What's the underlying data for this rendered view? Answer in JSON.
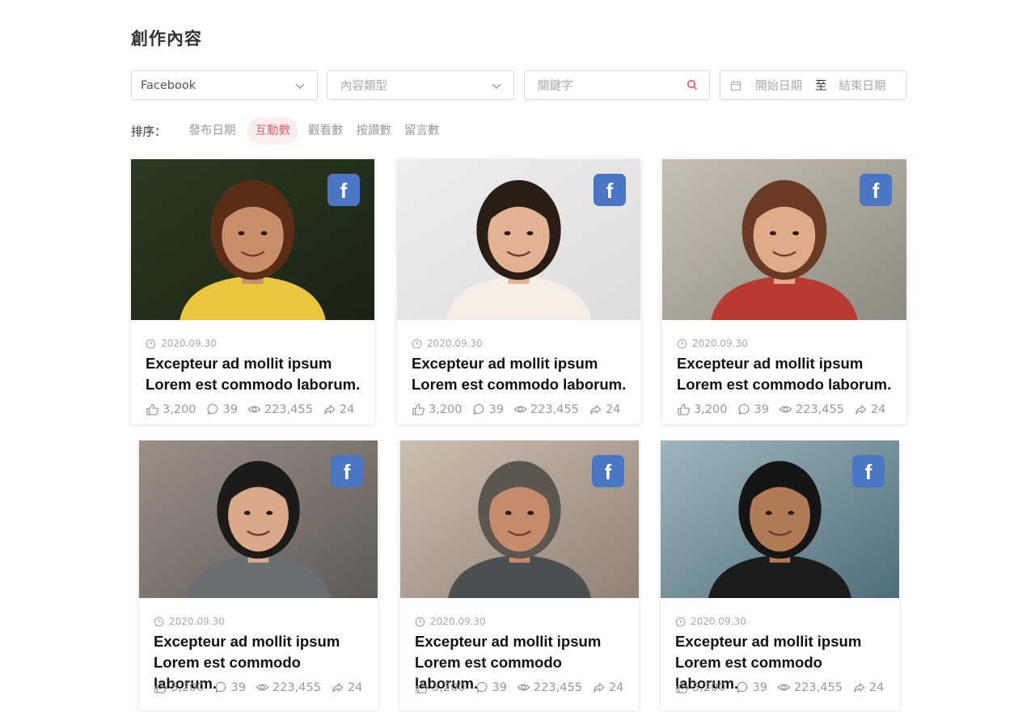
{
  "page": {
    "title": "創作內容"
  },
  "filters": {
    "platform": "Facebook",
    "content_type": "內容類型",
    "keyword": "關鍵字",
    "start_date": "開始日期",
    "separator": "至",
    "end_date": "結束日期"
  },
  "sort": {
    "label": "排序：",
    "options": [
      "發布日期",
      "互動數",
      "觀看數",
      "按讚數",
      "留言數"
    ],
    "active": "互動數"
  },
  "colors": {
    "accent": "#e0676c",
    "accent_bg": "#fbeced",
    "facebook": "#4a76c4"
  },
  "posts": [
    {
      "date": "2020.09.30",
      "title_line1": "Excepteur ad mollit ipsum",
      "title_line2": "Lorem est commodo laborum.",
      "likes": "3,200",
      "comments": "39",
      "views": "223,455",
      "shares": "24",
      "platform_icon": "facebook-icon"
    },
    {
      "date": "2020.09.30",
      "title_line1": "Excepteur ad mollit ipsum",
      "title_line2": "Lorem est commodo laborum.",
      "likes": "3,200",
      "comments": "39",
      "views": "223,455",
      "shares": "24",
      "platform_icon": "facebook-icon"
    },
    {
      "date": "2020.09.30",
      "title_line1": "Excepteur ad mollit ipsum",
      "title_line2": "Lorem est commodo laborum.",
      "likes": "3,200",
      "comments": "39",
      "views": "223,455",
      "shares": "24",
      "platform_icon": "facebook-icon"
    },
    {
      "date": "2020.09.30",
      "title_line1": "Excepteur ad mollit ipsum",
      "title_line2": "Lorem est commodo laborum.",
      "likes": "3,200",
      "comments": "39",
      "views": "223,455",
      "shares": "24",
      "platform_icon": "facebook-icon"
    },
    {
      "date": "2020.09.30",
      "title_line1": "Excepteur ad mollit ipsum",
      "title_line2": "Lorem est commodo laborum.",
      "likes": "3,200",
      "comments": "39",
      "views": "223,455",
      "shares": "24",
      "platform_icon": "facebook-icon"
    },
    {
      "date": "2020.09.30",
      "title_line1": "Excepteur ad mollit ipsum",
      "title_line2": "Lorem est commodo laborum.",
      "likes": "3,200",
      "comments": "39",
      "views": "223,455",
      "shares": "24",
      "platform_icon": "facebook-icon"
    }
  ]
}
